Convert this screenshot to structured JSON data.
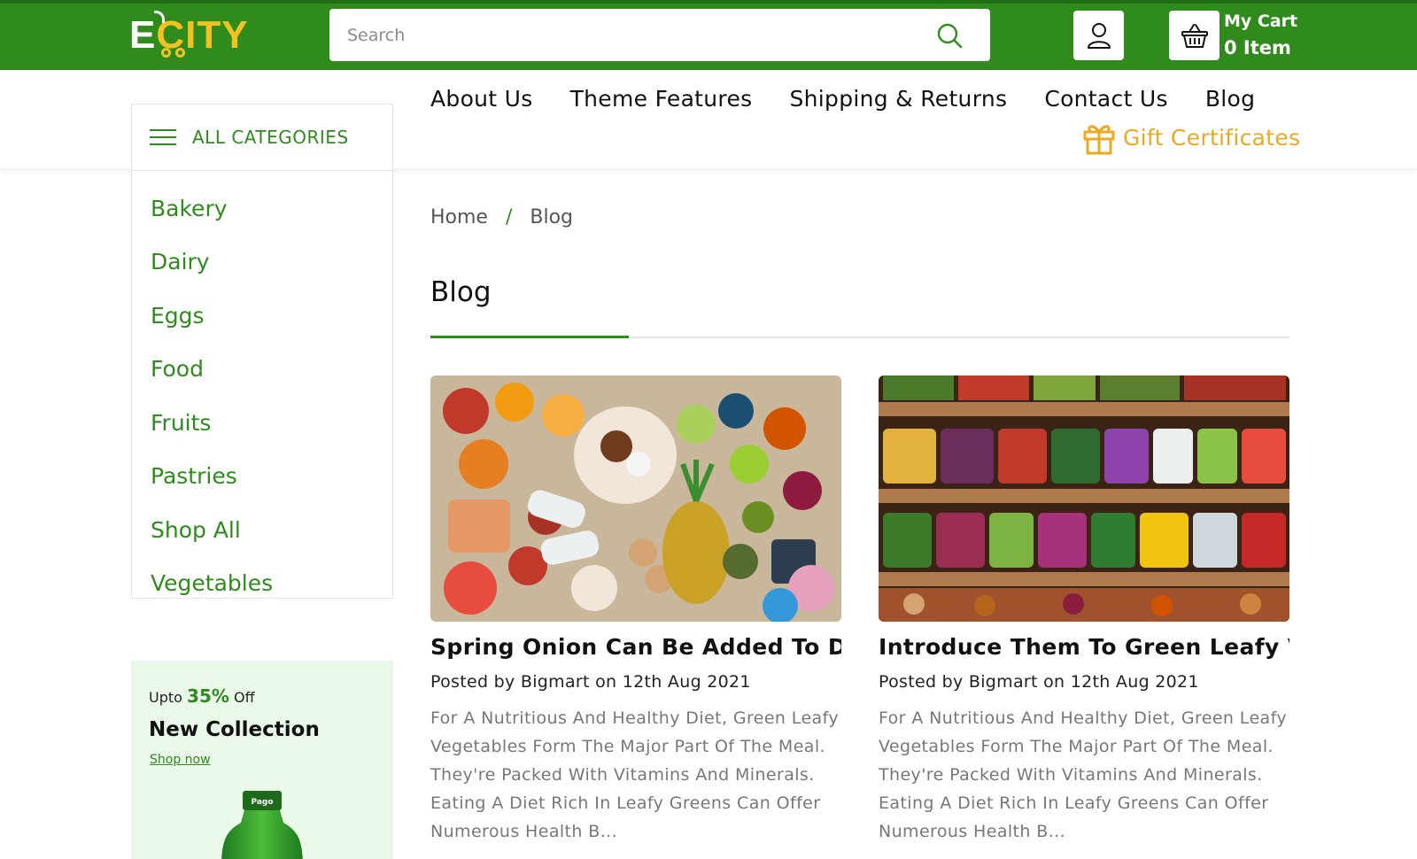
{
  "brand": {
    "logo_e": "E",
    "logo_rest": "CITY",
    "primary": "#2e8b1c",
    "accent": "#f3c221",
    "gift_color": "#e9a923"
  },
  "search": {
    "placeholder": "Search",
    "icon": "search-icon"
  },
  "cart": {
    "label": "My Cart",
    "count": "0 Item"
  },
  "nav": {
    "items": [
      "About Us",
      "Theme Features",
      "Shipping & Returns",
      "Contact Us",
      "Blog"
    ],
    "gift": "Gift Certificates"
  },
  "sidebar": {
    "title": "ALL CATEGORIES",
    "categories": [
      "Bakery",
      "Dairy",
      "Eggs",
      "Food",
      "Fruits",
      "Pastries",
      "Shop All",
      "Vegetables"
    ]
  },
  "promo": {
    "upto": "Upto",
    "percent": "35%",
    "off": "Off",
    "title": "New Collection",
    "link": "Shop now",
    "bottle_label": "Pago"
  },
  "breadcrumb": {
    "home": "Home",
    "sep": "/",
    "current": "Blog"
  },
  "page": {
    "title": "Blog"
  },
  "posts": [
    {
      "title": "Spring Onion Can Be Added To Dal",
      "meta": "Posted by Bigmart on 12th Aug 2021",
      "excerpt": "For A Nutritious And Healthy Diet, Green Leafy Vegetables Form The Major Part Of The Meal. They're Packed With Vitamins And Minerals. Eating A Diet Rich In Leafy Greens Can Offer Numerous Health B..."
    },
    {
      "title": "Introduce Them To Green Leafy Veg...",
      "meta": "Posted by Bigmart on 12th Aug 2021",
      "excerpt": "For A Nutritious And Healthy Diet, Green Leafy Vegetables Form The Major Part Of The Meal. They're Packed With Vitamins And Minerals. Eating A Diet Rich In Leafy Greens Can Offer Numerous Health B..."
    }
  ]
}
